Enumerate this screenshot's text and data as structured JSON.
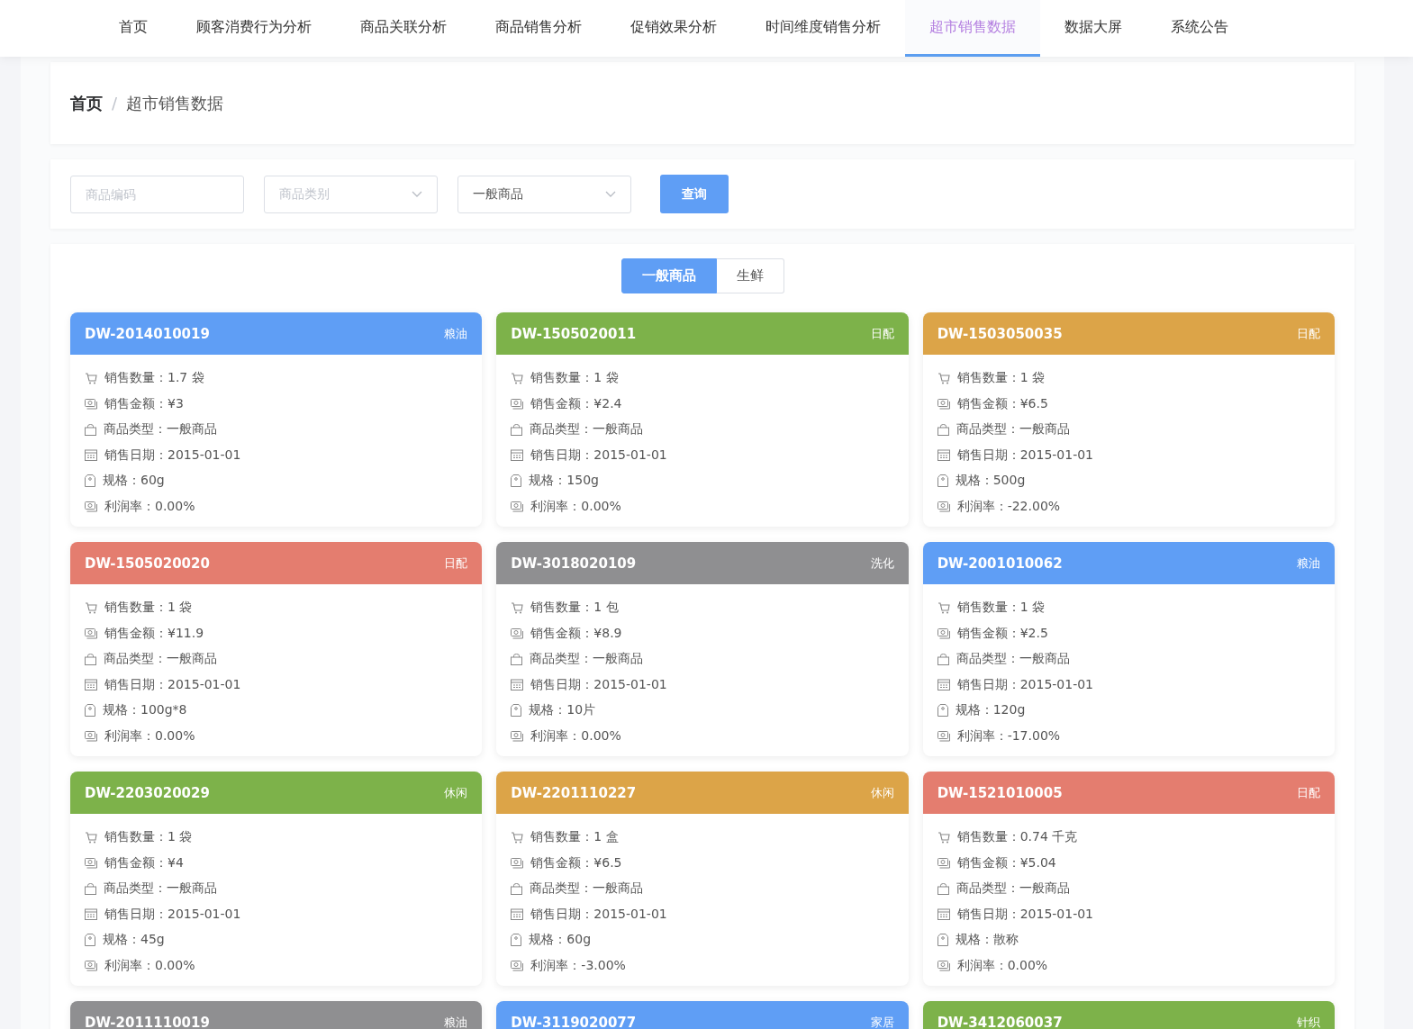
{
  "nav": [
    {
      "label": "首页",
      "selected": false
    },
    {
      "label": "顾客消费行为分析",
      "selected": false
    },
    {
      "label": "商品关联分析",
      "selected": false
    },
    {
      "label": "商品销售分析",
      "selected": false
    },
    {
      "label": "促销效果分析",
      "selected": false
    },
    {
      "label": "时间维度销售分析",
      "selected": false
    },
    {
      "label": "超市销售数据",
      "selected": true
    },
    {
      "label": "数据大屏",
      "selected": false
    },
    {
      "label": "系统公告",
      "selected": false
    }
  ],
  "breadcrumb": {
    "items": [
      "首页",
      "超市销售数据"
    ],
    "separator": "/"
  },
  "filters": {
    "code": {
      "placeholder": "商品编码"
    },
    "category": {
      "placeholder": "商品类别"
    },
    "type": {
      "value": "一般商品"
    },
    "search_button": "查询"
  },
  "type_tabs": [
    {
      "label": "一般商品",
      "selected": true
    },
    {
      "label": "生鲜",
      "selected": false
    }
  ],
  "cards": [
    {
      "code": "DW-2014010019",
      "category": "粮油",
      "color": "#5f9ef5",
      "fields": [
        {
          "kind": "cart",
          "text": "销售数量：1.7 袋"
        },
        {
          "kind": "money",
          "text": "销售金额：¥3"
        },
        {
          "kind": "bag",
          "text": "商品类型：一般商品"
        },
        {
          "kind": "calendar",
          "text": "销售日期：2015-01-01"
        },
        {
          "kind": "tag",
          "text": "规格：60g"
        },
        {
          "kind": "money",
          "text": "利润率：0.00%"
        }
      ]
    },
    {
      "code": "DW-1505020011",
      "category": "日配",
      "color": "#7db24a",
      "fields": [
        {
          "kind": "cart",
          "text": "销售数量：1 袋"
        },
        {
          "kind": "money",
          "text": "销售金额：¥2.4"
        },
        {
          "kind": "bag",
          "text": "商品类型：一般商品"
        },
        {
          "kind": "calendar",
          "text": "销售日期：2015-01-01"
        },
        {
          "kind": "tag",
          "text": "规格：150g"
        },
        {
          "kind": "money",
          "text": "利润率：0.00%"
        }
      ]
    },
    {
      "code": "DW-1503050035",
      "category": "日配",
      "color": "#dca448",
      "fields": [
        {
          "kind": "cart",
          "text": "销售数量：1 袋"
        },
        {
          "kind": "money",
          "text": "销售金额：¥6.5"
        },
        {
          "kind": "bag",
          "text": "商品类型：一般商品"
        },
        {
          "kind": "calendar",
          "text": "销售日期：2015-01-01"
        },
        {
          "kind": "tag",
          "text": "规格：500g"
        },
        {
          "kind": "money",
          "text": "利润率：-22.00%"
        }
      ]
    },
    {
      "code": "DW-1505020020",
      "category": "日配",
      "color": "#e47d6f",
      "fields": [
        {
          "kind": "cart",
          "text": "销售数量：1 袋"
        },
        {
          "kind": "money",
          "text": "销售金额：¥11.9"
        },
        {
          "kind": "bag",
          "text": "商品类型：一般商品"
        },
        {
          "kind": "calendar",
          "text": "销售日期：2015-01-01"
        },
        {
          "kind": "tag",
          "text": "规格：100g*8"
        },
        {
          "kind": "money",
          "text": "利润率：0.00%"
        }
      ]
    },
    {
      "code": "DW-3018020109",
      "category": "洗化",
      "color": "#8f8f91",
      "fields": [
        {
          "kind": "cart",
          "text": "销售数量：1 包"
        },
        {
          "kind": "money",
          "text": "销售金额：¥8.9"
        },
        {
          "kind": "bag",
          "text": "商品类型：一般商品"
        },
        {
          "kind": "calendar",
          "text": "销售日期：2015-01-01"
        },
        {
          "kind": "tag",
          "text": "规格：10片"
        },
        {
          "kind": "money",
          "text": "利润率：0.00%"
        }
      ]
    },
    {
      "code": "DW-2001010062",
      "category": "粮油",
      "color": "#5f9ef5",
      "fields": [
        {
          "kind": "cart",
          "text": "销售数量：1 袋"
        },
        {
          "kind": "money",
          "text": "销售金额：¥2.5"
        },
        {
          "kind": "bag",
          "text": "商品类型：一般商品"
        },
        {
          "kind": "calendar",
          "text": "销售日期：2015-01-01"
        },
        {
          "kind": "tag",
          "text": "规格：120g"
        },
        {
          "kind": "money",
          "text": "利润率：-17.00%"
        }
      ]
    },
    {
      "code": "DW-2203020029",
      "category": "休闲",
      "color": "#7db24a",
      "fields": [
        {
          "kind": "cart",
          "text": "销售数量：1 袋"
        },
        {
          "kind": "money",
          "text": "销售金额：¥4"
        },
        {
          "kind": "bag",
          "text": "商品类型：一般商品"
        },
        {
          "kind": "calendar",
          "text": "销售日期：2015-01-01"
        },
        {
          "kind": "tag",
          "text": "规格：45g"
        },
        {
          "kind": "money",
          "text": "利润率：0.00%"
        }
      ]
    },
    {
      "code": "DW-2201110227",
      "category": "休闲",
      "color": "#dca448",
      "fields": [
        {
          "kind": "cart",
          "text": "销售数量：1 盒"
        },
        {
          "kind": "money",
          "text": "销售金额：¥6.5"
        },
        {
          "kind": "bag",
          "text": "商品类型：一般商品"
        },
        {
          "kind": "calendar",
          "text": "销售日期：2015-01-01"
        },
        {
          "kind": "tag",
          "text": "规格：60g"
        },
        {
          "kind": "money",
          "text": "利润率：-3.00%"
        }
      ]
    },
    {
      "code": "DW-1521010005",
      "category": "日配",
      "color": "#e47d6f",
      "fields": [
        {
          "kind": "cart",
          "text": "销售数量：0.74 千克"
        },
        {
          "kind": "money",
          "text": "销售金额：¥5.04"
        },
        {
          "kind": "bag",
          "text": "商品类型：一般商品"
        },
        {
          "kind": "calendar",
          "text": "销售日期：2015-01-01"
        },
        {
          "kind": "tag",
          "text": "规格：散称"
        },
        {
          "kind": "money",
          "text": "利润率：0.00%"
        }
      ]
    },
    {
      "code": "DW-2011110019",
      "category": "粮油",
      "color": "#8f8f91"
    },
    {
      "code": "DW-3119020077",
      "category": "家居",
      "color": "#5f9ef5"
    },
    {
      "code": "DW-3412060037",
      "category": "针织",
      "color": "#7db24a"
    }
  ]
}
